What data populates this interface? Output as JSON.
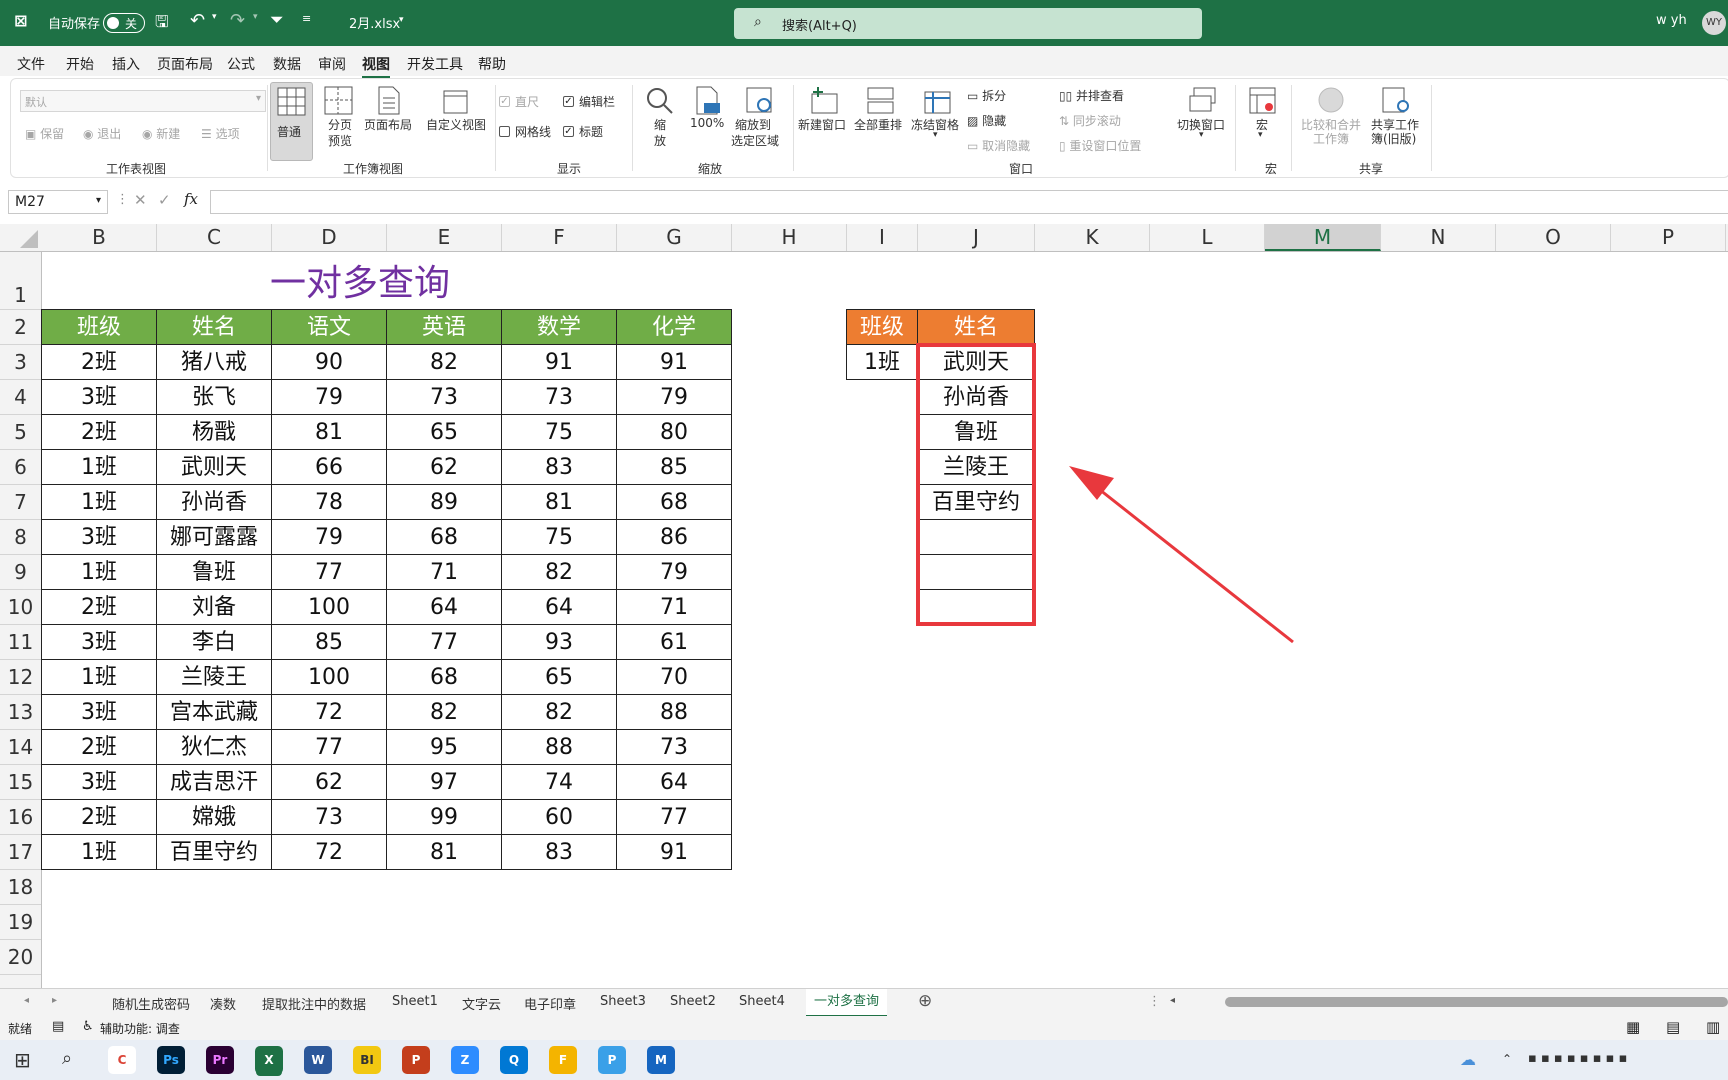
{
  "titlebar": {
    "autosave_label": "自动保存",
    "autosave_state": "关",
    "filename": "2月.xlsx",
    "search_placeholder": "搜索(Alt+Q)",
    "user": "w yh",
    "avatar": "WY"
  },
  "menu": [
    "文件",
    "开始",
    "插入",
    "页面布局",
    "公式",
    "数据",
    "审阅",
    "视图",
    "开发工具",
    "帮助"
  ],
  "active_menu": "视图",
  "ribbon": {
    "sheetview": {
      "dropdown": "默认",
      "keep": "保留",
      "exit": "退出",
      "new": "新建",
      "options": "选项",
      "group": "工作表视图"
    },
    "workbookview": {
      "normal": "普通",
      "pagebreak1": "分页",
      "pagebreak2": "预览",
      "pagelayout": "页面布局",
      "custom": "自定义视图",
      "group": "工作簿视图"
    },
    "show": {
      "ruler": "直尺",
      "formulabar": "编辑栏",
      "gridlines": "网格线",
      "headings": "标题",
      "group": "显示"
    },
    "zoom": {
      "zoom1": "缩",
      "zoom2": "放",
      "hundred": "100%",
      "toselect1": "缩放到",
      "toselect2": "选定区域",
      "group": "缩放"
    },
    "window": {
      "newwin": "新建窗口",
      "arrange": "全部重排",
      "freeze": "冻结窗格",
      "split": "拆分",
      "hide": "隐藏",
      "unhide": "取消隐藏",
      "sidebyside": "并排查看",
      "syncscroll": "同步滚动",
      "resetpos": "重设窗口位置",
      "switch": "切换窗口",
      "group": "窗口"
    },
    "macro": {
      "macro": "宏",
      "group": "宏"
    },
    "share": {
      "compare1": "比较和合并",
      "compare2": "工作簿",
      "shared1": "共享工作",
      "shared2": "簿(旧版)",
      "group": "共享"
    }
  },
  "formula": {
    "namebox": "M27",
    "value": ""
  },
  "columns": [
    "B",
    "C",
    "D",
    "E",
    "F",
    "G",
    "H",
    "I",
    "J",
    "K",
    "L",
    "M",
    "N",
    "O",
    "P"
  ],
  "selected_column": "M",
  "rows": [
    "1",
    "2",
    "3",
    "4",
    "5",
    "6",
    "7",
    "8",
    "9",
    "10",
    "11",
    "12",
    "13",
    "14",
    "15",
    "16",
    "17",
    "18",
    "19",
    "20"
  ],
  "sheet_title": "一对多查询",
  "table": {
    "headers": [
      "班级",
      "姓名",
      "语文",
      "英语",
      "数学",
      "化学"
    ],
    "header_color": "#70ad47",
    "rows": [
      [
        "2班",
        "猪八戒",
        "90",
        "82",
        "91",
        "91"
      ],
      [
        "3班",
        "张飞",
        "79",
        "73",
        "73",
        "79"
      ],
      [
        "2班",
        "杨戬",
        "81",
        "65",
        "75",
        "80"
      ],
      [
        "1班",
        "武则天",
        "66",
        "62",
        "83",
        "85"
      ],
      [
        "1班",
        "孙尚香",
        "78",
        "89",
        "81",
        "68"
      ],
      [
        "3班",
        "娜可露露",
        "79",
        "68",
        "75",
        "86"
      ],
      [
        "1班",
        "鲁班",
        "77",
        "71",
        "82",
        "79"
      ],
      [
        "2班",
        "刘备",
        "100",
        "64",
        "64",
        "71"
      ],
      [
        "3班",
        "李白",
        "85",
        "77",
        "93",
        "61"
      ],
      [
        "1班",
        "兰陵王",
        "100",
        "68",
        "65",
        "70"
      ],
      [
        "3班",
        "宫本武藏",
        "72",
        "82",
        "82",
        "88"
      ],
      [
        "2班",
        "狄仁杰",
        "77",
        "95",
        "88",
        "73"
      ],
      [
        "3班",
        "成吉思汗",
        "62",
        "97",
        "74",
        "64"
      ],
      [
        "2班",
        "嫦娥",
        "73",
        "99",
        "60",
        "77"
      ],
      [
        "1班",
        "百里守约",
        "72",
        "81",
        "83",
        "91"
      ]
    ]
  },
  "lookup": {
    "headers": [
      "班级",
      "姓名"
    ],
    "header_color": "#ed7d31",
    "class_value": "1班",
    "results": [
      "武则天",
      "孙尚香",
      "鲁班",
      "兰陵王",
      "百里守约",
      "",
      "",
      ""
    ],
    "highlight_color": "#e8383d"
  },
  "sheet_tabs": [
    "随机生成密码",
    "凑数",
    "提取批注中的数据",
    "Sheet1",
    "文字云",
    "电子印章",
    "Sheet3",
    "Sheet2",
    "Sheet4",
    "一对多查询"
  ],
  "active_sheet": "一对多查询",
  "status": {
    "ready": "就绪",
    "accessibility": "辅助功能: 调查"
  },
  "taskbar_apps": [
    "Chrome",
    "Ps",
    "Pr",
    "X",
    "W",
    "BI",
    "P",
    "Zoom",
    "Q",
    "Files",
    "Photos",
    "Mail"
  ]
}
